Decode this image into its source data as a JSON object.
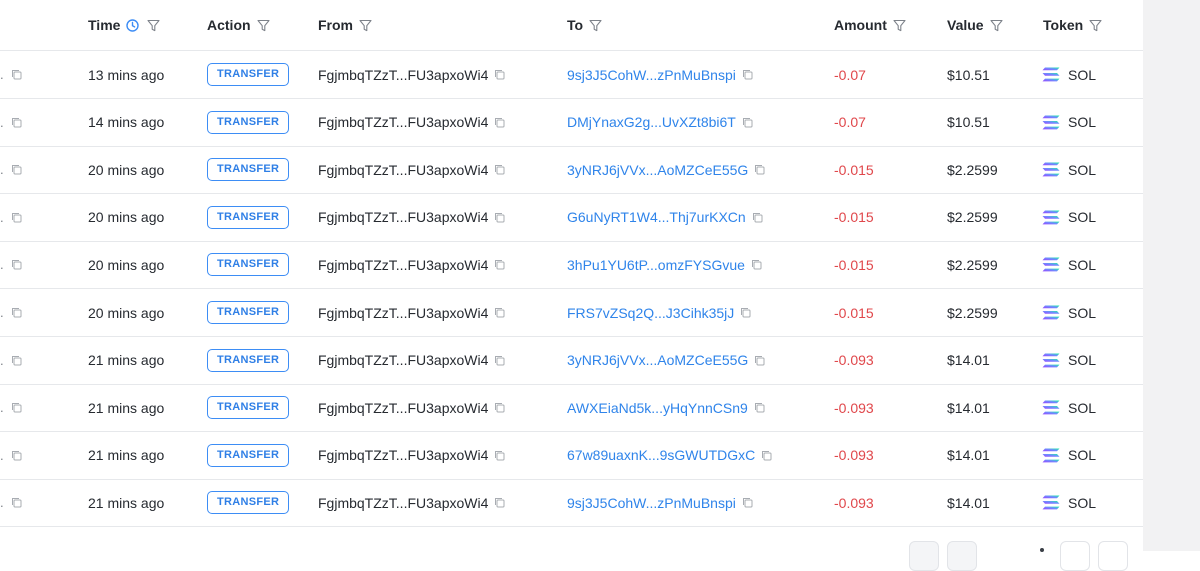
{
  "header": {
    "time": "Time",
    "action": "Action",
    "from": "From",
    "to": "To",
    "amount": "Amount",
    "value": "Value",
    "token": "Token"
  },
  "colors": {
    "link": "#2f84ea",
    "negative": "#e0474b",
    "badge": "#3d8df5"
  },
  "rows": [
    {
      "prefix": ".",
      "time": "13 mins ago",
      "action": "TRANSFER",
      "from": "FgjmbqTZzT...FU3apxoWi4",
      "to": "9sj3J5CohW...zPnMuBnspi",
      "amount": "-0.07",
      "value": "$10.51",
      "token": "SOL"
    },
    {
      "prefix": ".",
      "time": "14 mins ago",
      "action": "TRANSFER",
      "from": "FgjmbqTZzT...FU3apxoWi4",
      "to": "DMjYnaxG2g...UvXZt8bi6T",
      "amount": "-0.07",
      "value": "$10.51",
      "token": "SOL"
    },
    {
      "prefix": ".",
      "time": "20 mins ago",
      "action": "TRANSFER",
      "from": "FgjmbqTZzT...FU3apxoWi4",
      "to": "3yNRJ6jVVx...AoMZCeE55G",
      "amount": "-0.015",
      "value": "$2.2599",
      "token": "SOL"
    },
    {
      "prefix": ".",
      "time": "20 mins ago",
      "action": "TRANSFER",
      "from": "FgjmbqTZzT...FU3apxoWi4",
      "to": "G6uNyRT1W4...Thj7urKXCn",
      "amount": "-0.015",
      "value": "$2.2599",
      "token": "SOL"
    },
    {
      "prefix": ".",
      "time": "20 mins ago",
      "action": "TRANSFER",
      "from": "FgjmbqTZzT...FU3apxoWi4",
      "to": "3hPu1YU6tP...omzFYSGvue",
      "amount": "-0.015",
      "value": "$2.2599",
      "token": "SOL"
    },
    {
      "prefix": ".",
      "time": "20 mins ago",
      "action": "TRANSFER",
      "from": "FgjmbqTZzT...FU3apxoWi4",
      "to": "FRS7vZSq2Q...J3Cihk35jJ",
      "amount": "-0.015",
      "value": "$2.2599",
      "token": "SOL"
    },
    {
      "prefix": ".",
      "time": "21 mins ago",
      "action": "TRANSFER",
      "from": "FgjmbqTZzT...FU3apxoWi4",
      "to": "3yNRJ6jVVx...AoMZCeE55G",
      "amount": "-0.093",
      "value": "$14.01",
      "token": "SOL"
    },
    {
      "prefix": ".",
      "time": "21 mins ago",
      "action": "TRANSFER",
      "from": "FgjmbqTZzT...FU3apxoWi4",
      "to": "AWXEiaNd5k...yHqYnnCSn9",
      "amount": "-0.093",
      "value": "$14.01",
      "token": "SOL"
    },
    {
      "prefix": ".",
      "time": "21 mins ago",
      "action": "TRANSFER",
      "from": "FgjmbqTZzT...FU3apxoWi4",
      "to": "67w89uaxnK...9sGWUTDGxC",
      "amount": "-0.093",
      "value": "$14.01",
      "token": "SOL"
    },
    {
      "prefix": ".",
      "time": "21 mins ago",
      "action": "TRANSFER",
      "from": "FgjmbqTZzT...FU3apxoWi4",
      "to": "9sj3J5CohW...zPnMuBnspi",
      "amount": "-0.093",
      "value": "$14.01",
      "token": "SOL"
    }
  ]
}
